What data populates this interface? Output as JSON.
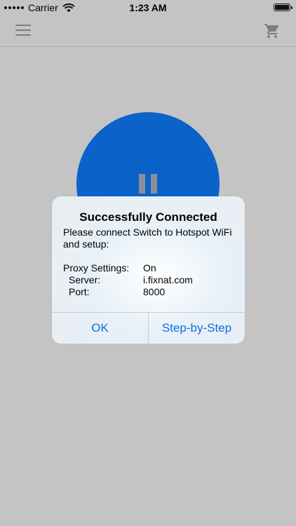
{
  "status_bar": {
    "carrier": "Carrier",
    "time": "1:23 AM",
    "battery_level": 1.0
  },
  "nav_bar": {
    "menu_icon": "hamburger-menu-icon",
    "cart_icon": "shopping-cart-icon",
    "icon_color": "#7e7e7e"
  },
  "main": {
    "connect_button_color": "#0b62c9",
    "connect_button_icon": "pause-icon"
  },
  "alert": {
    "title": "Successfully Connected",
    "message": "Please connect Switch to Hotspot WiFi and setup:",
    "settings": [
      {
        "key": "Proxy Settings:",
        "value": "On"
      },
      {
        "key": "Server:",
        "value": "i.fixnat.com"
      },
      {
        "key": "Port:",
        "value": "8000"
      }
    ],
    "buttons": {
      "ok": "OK",
      "step_by_step": "Step-by-Step"
    },
    "accent_color": "#0a6fe0"
  }
}
